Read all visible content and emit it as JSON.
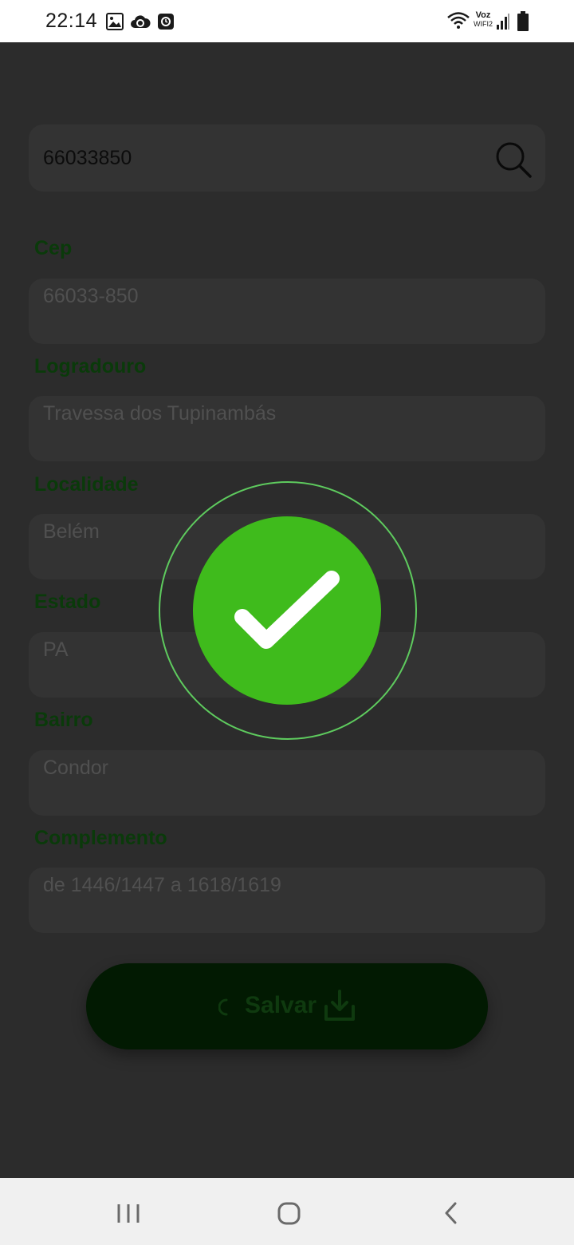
{
  "status_bar": {
    "time": "22:14",
    "icons": [
      "image-icon",
      "cloud-sync-icon",
      "clock-app-icon"
    ],
    "wifi_label_top": "Voz",
    "wifi_label_bottom": "WIFI2",
    "right_icons": [
      "wifi-icon",
      "signal-icon",
      "battery-icon"
    ]
  },
  "search": {
    "value": "66033850",
    "icon": "search-icon"
  },
  "fields": {
    "cep": {
      "label": "Cep",
      "value": "66033-850"
    },
    "logradouro": {
      "label": "Logradouro",
      "value": "Travessa dos Tupinambás"
    },
    "localidade": {
      "label": "Localidade",
      "value": "Belém"
    },
    "estado": {
      "label": "Estado",
      "value": "PA"
    },
    "bairro": {
      "label": "Bairro",
      "value": "Condor"
    },
    "complemento": {
      "label": "Complemento",
      "value": "de 1446/1447 a 1618/1619"
    }
  },
  "save_button": {
    "label": "Salvar",
    "icons": [
      "spinner-icon",
      "download-icon"
    ]
  },
  "overlay": {
    "icon": "check-icon",
    "color": "#3fbb1c"
  },
  "nav_bar": {
    "icons": [
      "recent-apps-icon",
      "home-icon",
      "back-icon"
    ]
  }
}
